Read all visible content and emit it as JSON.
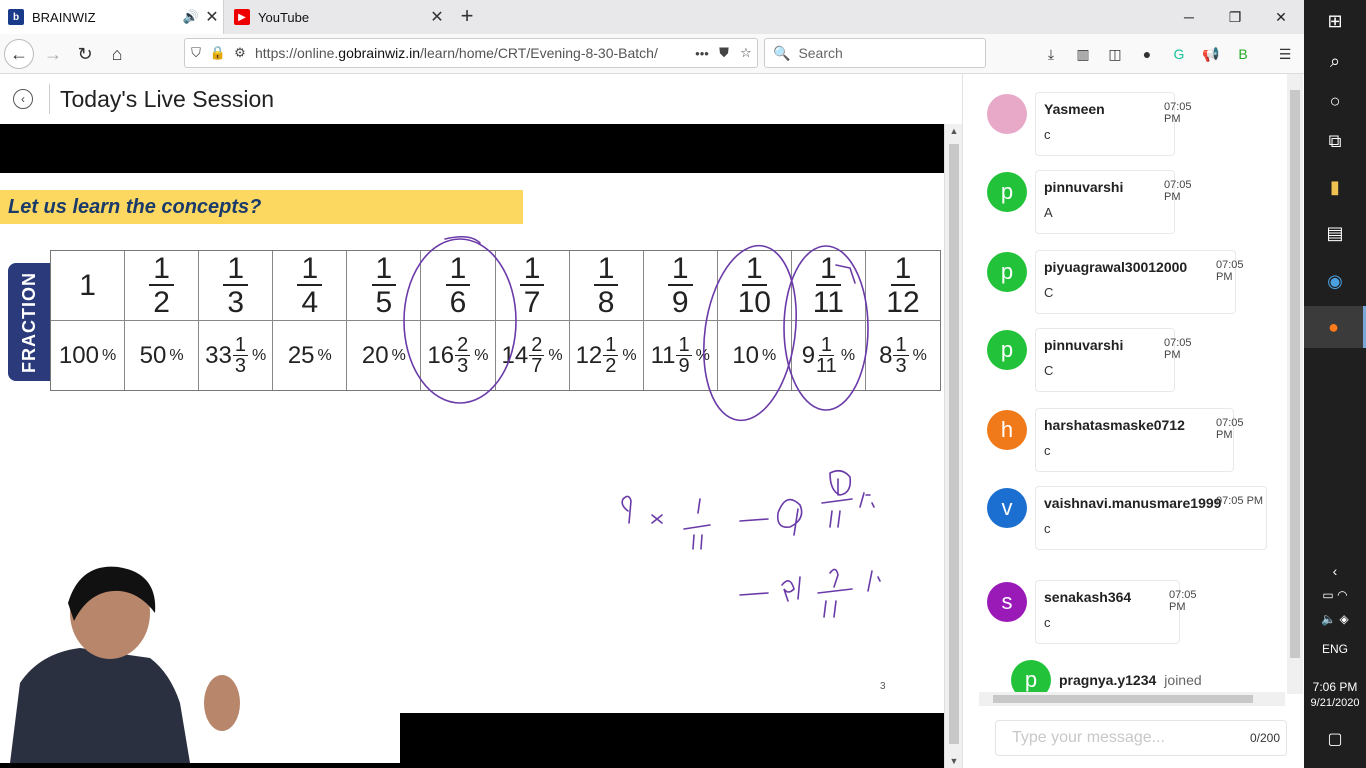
{
  "browser": {
    "tabs": [
      {
        "title": "BRAINWIZ",
        "favicon": "brainwiz-icon",
        "audio": "speaker-icon"
      },
      {
        "title": "YouTube",
        "favicon": "youtube-icon"
      }
    ],
    "url_prefix": "https://online.",
    "url_domain": "gobrainwiz.in",
    "url_path": "/learn/home/CRT/Evening-8-30-Batch/",
    "search_placeholder": "Search"
  },
  "page": {
    "title": "Today's Live Session"
  },
  "slide": {
    "banner": "Let us learn the concepts?",
    "side_label": "FRACTION",
    "page_number": "3",
    "fractions": [
      {
        "whole": "1"
      },
      {
        "n": "1",
        "d": "2"
      },
      {
        "n": "1",
        "d": "3"
      },
      {
        "n": "1",
        "d": "4"
      },
      {
        "n": "1",
        "d": "5"
      },
      {
        "n": "1",
        "d": "6"
      },
      {
        "n": "1",
        "d": "7"
      },
      {
        "n": "1",
        "d": "8"
      },
      {
        "n": "1",
        "d": "9"
      },
      {
        "n": "1",
        "d": "10"
      },
      {
        "n": "1",
        "d": "11"
      },
      {
        "n": "1",
        "d": "12"
      }
    ],
    "percents": [
      {
        "int": "100"
      },
      {
        "int": "50"
      },
      {
        "int": "33",
        "n": "1",
        "d": "3"
      },
      {
        "int": "25"
      },
      {
        "int": "20"
      },
      {
        "int": "16",
        "n": "2",
        "d": "3"
      },
      {
        "int": "14",
        "n": "2",
        "d": "7"
      },
      {
        "int": "12",
        "n": "1",
        "d": "2"
      },
      {
        "int": "11",
        "n": "1",
        "d": "9"
      },
      {
        "int": "10"
      },
      {
        "int": "9",
        "n": "1",
        "d": "11"
      },
      {
        "int": "8",
        "n": "1",
        "d": "3"
      }
    ],
    "pct_sign": "%"
  },
  "chat": {
    "messages": [
      {
        "name": "Yasmeen",
        "time": "07:05 PM",
        "text": "c",
        "avatar": "",
        "color": "#e8a8c8"
      },
      {
        "name": "pinnuvarshi",
        "time": "07:05 PM",
        "text": "A",
        "avatar": "p",
        "color": "#22c33a"
      },
      {
        "name": "piyuagrawal30012000",
        "time": "07:05 PM",
        "text": "C",
        "avatar": "p",
        "color": "#22c33a"
      },
      {
        "name": "pinnuvarshi",
        "time": "07:05 PM",
        "text": "C",
        "avatar": "p",
        "color": "#22c33a"
      },
      {
        "name": "harshatasmaske0712",
        "time": "07:05 PM",
        "text": "c",
        "avatar": "h",
        "color": "#f07a1a"
      },
      {
        "name": "vaishnavi.manusmare1999",
        "time": "07:05 PM",
        "text": "c",
        "avatar": "v",
        "color": "#1a6fd0"
      },
      {
        "name": "senakash364",
        "time": "07:05 PM",
        "text": "c",
        "avatar": "s",
        "color": "#9a1ab8"
      }
    ],
    "joined": {
      "avatar": "p",
      "name": "pragnya.y1234",
      "text": "joined"
    },
    "input_placeholder": "Type your message...",
    "char_count": "0/200"
  },
  "taskbar": {
    "language": "ENG",
    "time": "7:06 PM",
    "date": "9/21/2020"
  }
}
